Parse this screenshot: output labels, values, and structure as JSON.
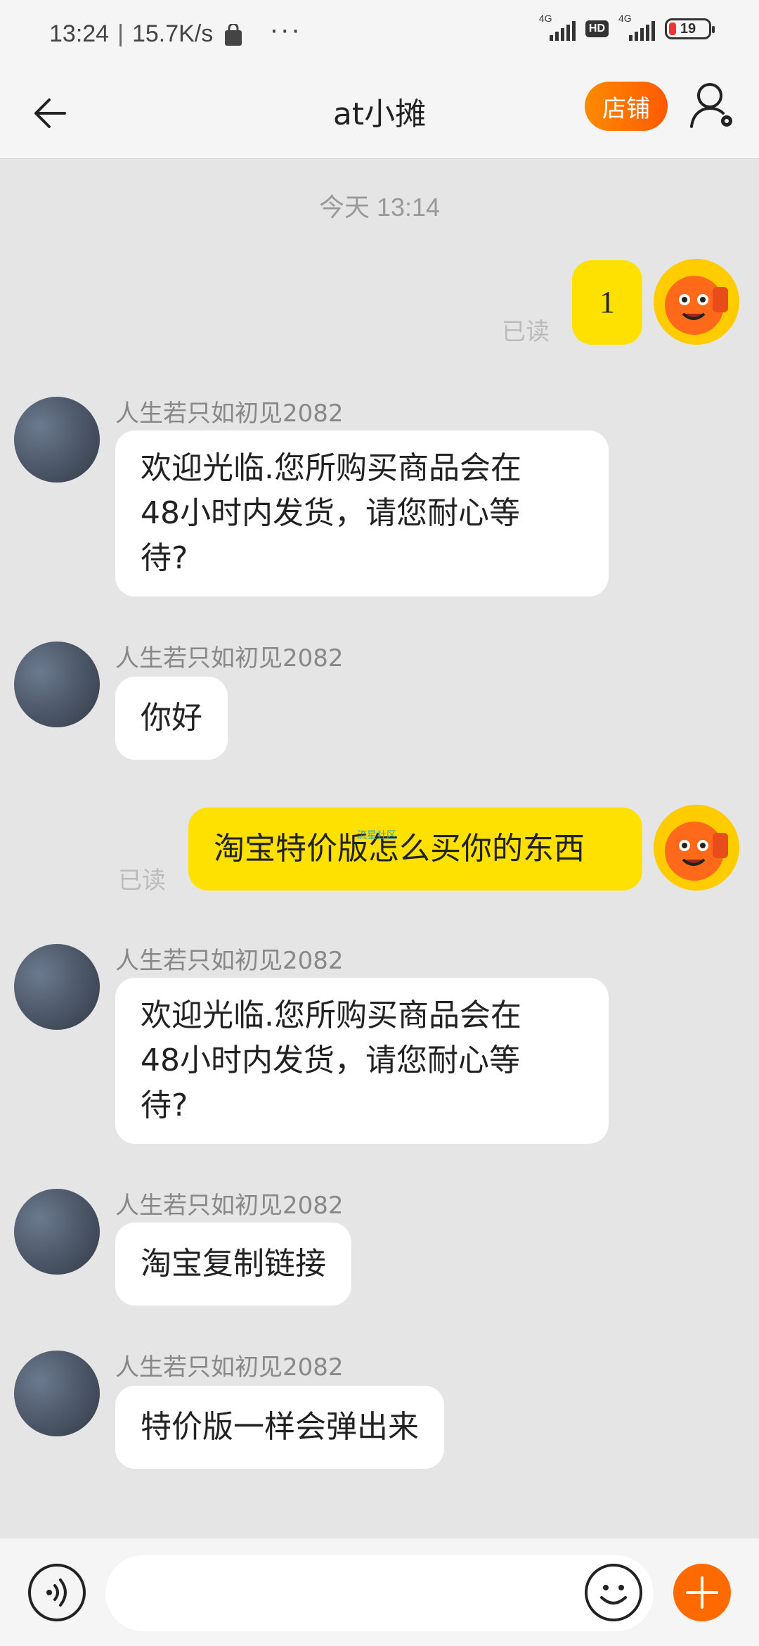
{
  "status_bar": {
    "time": "13:24",
    "separator": "|",
    "net_speed": "15.7K/s",
    "more": "···",
    "net1_label": "4G",
    "hd_label": "HD",
    "net2_label": "4G",
    "battery": "19"
  },
  "nav": {
    "title": "at小摊",
    "shop_label": "店铺"
  },
  "chat": {
    "time_separator": "今天  13:14",
    "messages": [
      {
        "from": "self",
        "text": "1",
        "read": "已读"
      },
      {
        "from": "other",
        "sender": "人生若只如初见2082",
        "lines": [
          "欢迎光临.您所购买商品会在",
          "48小时内发货，请您耐心等",
          "待?"
        ]
      },
      {
        "from": "other",
        "sender": "人生若只如初见2082",
        "text": "你好"
      },
      {
        "from": "self",
        "text": "淘宝特价版怎么买你的东西",
        "read": "已读",
        "watermark": "流星社区"
      },
      {
        "from": "other",
        "sender": "人生若只如初见2082",
        "lines": [
          "欢迎光临.您所购买商品会在",
          "48小时内发货，请您耐心等",
          "待?"
        ]
      },
      {
        "from": "other",
        "sender": "人生若只如初见2082",
        "text": "淘宝复制链接"
      },
      {
        "from": "other",
        "sender": "人生若只如初见2082",
        "text": "特价版一样会弹出来"
      }
    ]
  },
  "input_bar": {
    "placeholder": "",
    "accent_color": "#ff6a00"
  },
  "colors": {
    "self_bubble": "#ffe100",
    "other_bubble": "#ffffff",
    "background": "#e5e5e5",
    "shop_button": "#ff6a00"
  }
}
